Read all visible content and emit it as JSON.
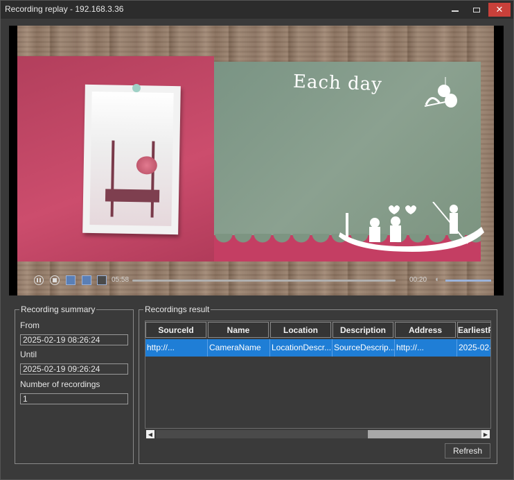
{
  "window": {
    "title": "Recording replay - 192.168.3.36"
  },
  "player": {
    "overlay_text": "Each day",
    "current_time": "05:58",
    "end_time": "00:20",
    "progress_percent": 100
  },
  "summary": {
    "legend": "Recording summary",
    "from_label": "From",
    "from_value": "2025-02-19 08:26:24",
    "until_label": "Until",
    "until_value": "2025-02-19 09:26:24",
    "count_label": "Number of recordings",
    "count_value": "1"
  },
  "results": {
    "legend": "Recordings result",
    "columns": [
      "SourceId",
      "Name",
      "Location",
      "Description",
      "Address",
      "EarliestRe"
    ],
    "rows": [
      [
        "http://...",
        "CameraName",
        "LocationDescr...",
        "SourceDescrip...",
        "http://...",
        "2025-02-"
      ]
    ],
    "refresh_label": "Refresh"
  },
  "colors": {
    "selection": "#1f7ed6",
    "close_button": "#c9403a"
  }
}
